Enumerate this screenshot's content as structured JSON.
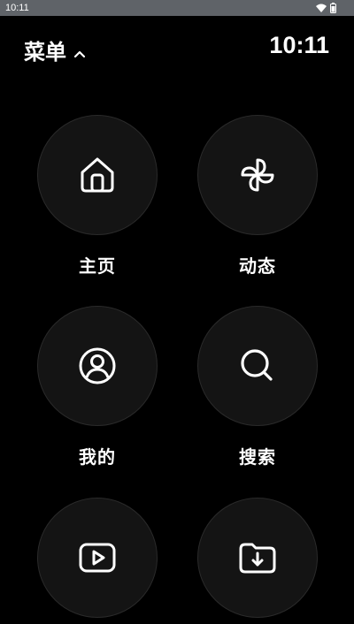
{
  "status_bar": {
    "time": "10:11",
    "icons": [
      "wifi-icon",
      "battery-icon"
    ]
  },
  "header": {
    "title": "菜单",
    "title_icon": "chevron-up-icon",
    "clock": "10:11"
  },
  "menu": {
    "items": [
      {
        "label": "主页",
        "icon": "home-icon"
      },
      {
        "label": "动态",
        "icon": "fan-icon"
      },
      {
        "label": "我的",
        "icon": "user-icon"
      },
      {
        "label": "搜索",
        "icon": "search-icon"
      },
      {
        "label": "",
        "icon": "play-icon"
      },
      {
        "label": "",
        "icon": "folder-download-icon"
      }
    ]
  },
  "colors": {
    "background": "#000000",
    "status_bar": "#5f6368",
    "tile": "#141414",
    "text": "#ffffff"
  }
}
